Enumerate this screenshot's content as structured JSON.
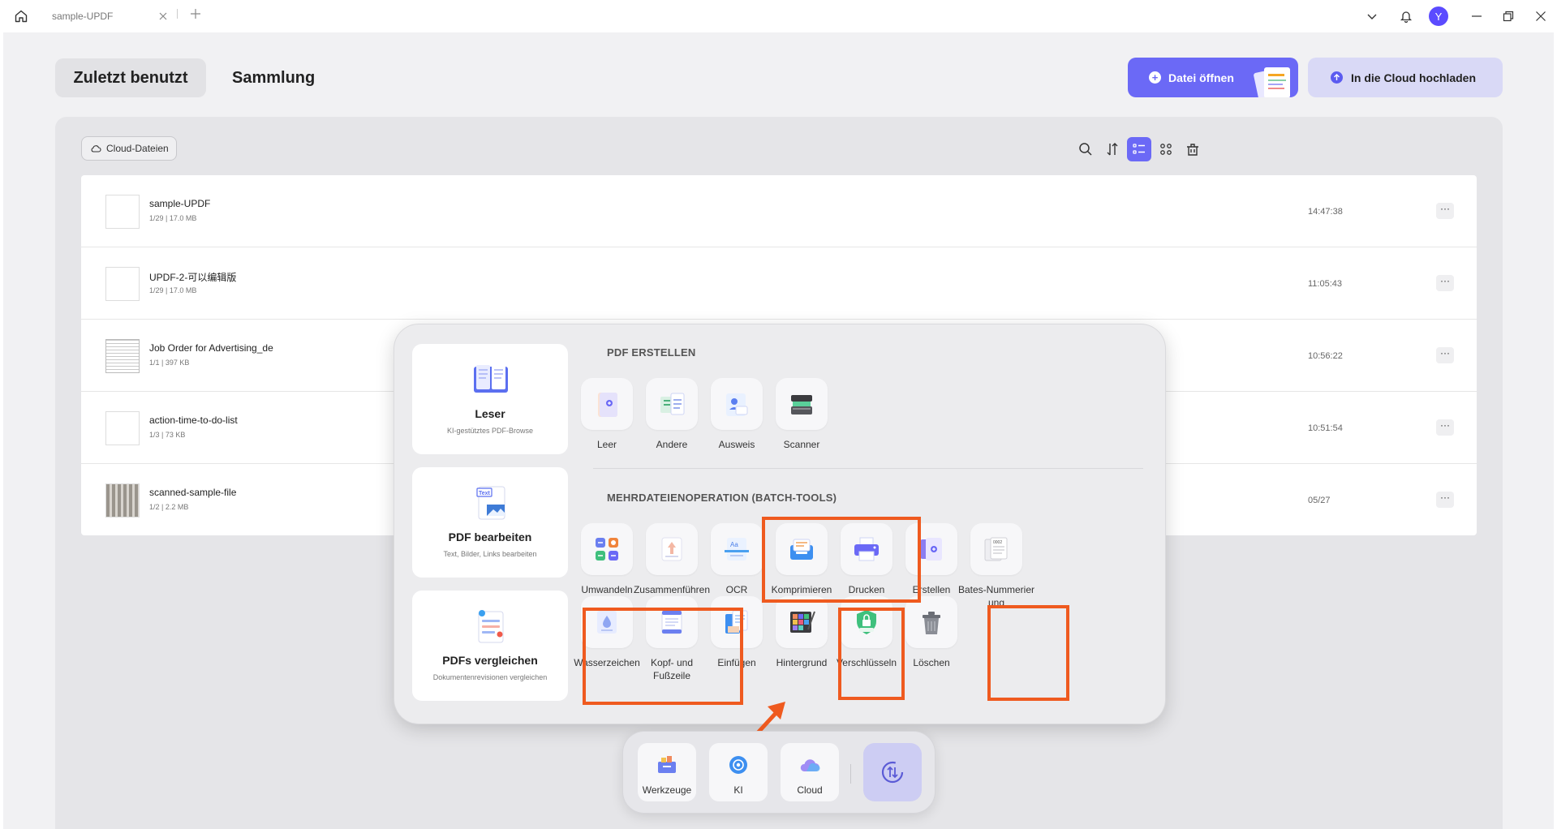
{
  "titlebar": {
    "tab_title": "sample-UPDF",
    "avatar_initial": "Y",
    "icons": [
      "home-icon",
      "close-icon",
      "plus-icon",
      "chevron-down-icon",
      "bell-icon",
      "minimize-icon",
      "restore-icon",
      "window-close-icon"
    ]
  },
  "header": {
    "tabs": [
      "Zuletzt benutzt",
      "Sammlung"
    ],
    "active_tab": "Zuletzt benutzt",
    "open_file_label": "Datei öffnen",
    "upload_cloud_label": "In die Cloud hochladen"
  },
  "files_panel": {
    "cloud_chip_label": "Cloud-Dateien",
    "toolbar_icons": [
      "search-icon",
      "sort-icon",
      "list-view-icon",
      "grid-view-icon",
      "trash-icon"
    ],
    "active_view": "list-view-icon",
    "files": [
      {
        "name": "sample-UPDF",
        "meta": "1/29 | 17.0 MB",
        "time": "14:47:38"
      },
      {
        "name": "UPDF-2-可以编辑版",
        "meta": "1/29 | 17.0 MB",
        "time": "11:05:43"
      },
      {
        "name": "Job Order for Advertising_de",
        "meta": "1/1 | 397 KB",
        "time": "10:56:22"
      },
      {
        "name": "action-time-to-do-list",
        "meta": "1/3 | 73 KB",
        "time": "10:51:54"
      },
      {
        "name": "scanned-sample-file",
        "meta": "1/2 | 2.2 MB",
        "time": "05/27"
      }
    ],
    "more_label": "···"
  },
  "popup": {
    "features": [
      {
        "title": "Leser",
        "subtitle": "KI-gestütztes PDF-Browse"
      },
      {
        "title": "PDF bearbeiten",
        "subtitle": "Text, Bilder, Links bearbeiten"
      },
      {
        "title": "PDFs vergleichen",
        "subtitle": "Dokumentenrevisionen vergleichen"
      }
    ],
    "create_title": "PDF ERSTELLEN",
    "create_tools": [
      "Leer",
      "Andere",
      "Ausweis",
      "Scanner"
    ],
    "batch_title": "MEHRDATEIENOPERATION (BATCH-TOOLS)",
    "batch_row1": [
      "Umwandeln",
      "Zusammenführen",
      "OCR",
      "Komprimieren",
      "Drucken",
      "Erstellen",
      "Bates-Nummerier ung"
    ],
    "batch_row2": [
      "Wasserzeichen",
      "Kopf- und Fußzeile",
      "Einfügen",
      "Hintergrund",
      "Verschlüsseln",
      "Löschen"
    ]
  },
  "dock": {
    "items": [
      "Werkzeuge",
      "KI",
      "Cloud"
    ]
  },
  "colors": {
    "accent": "#6b69f6",
    "highlight": "#ef5a1f"
  }
}
